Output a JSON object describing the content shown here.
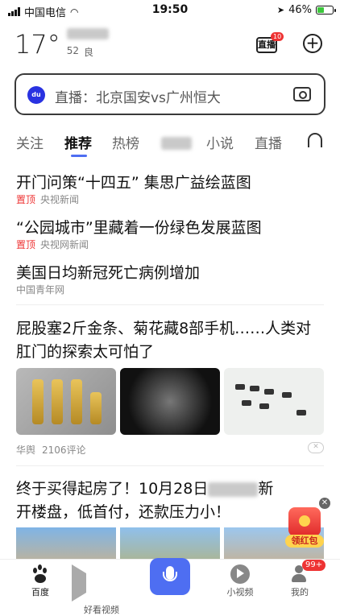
{
  "status_bar": {
    "carrier": "中国电信",
    "time": "19:50",
    "battery": "46%",
    "battery_level": 0.46
  },
  "weather": {
    "temperature": "17°",
    "aqi_value": "52",
    "aqi_label": "良"
  },
  "header": {
    "live_label": "直播",
    "live_badge": "10"
  },
  "search": {
    "text": "直播：北京国安vs广州恒大"
  },
  "tabs": [
    "关注",
    "推荐",
    "热榜",
    "小说",
    "直播"
  ],
  "top_news": [
    {
      "title": "开门问策“十四五” 集思广益绘蓝图",
      "pinned": "置顶",
      "source": "央视新闻"
    },
    {
      "title": "“公园城市”里藏着一份绿色发展蓝图",
      "pinned": "置顶",
      "source": "央视网新闻"
    },
    {
      "title": "美国日均新冠死亡病例增加",
      "pinned": "",
      "source": "中国青年网"
    }
  ],
  "article1": {
    "title": "屁股塞2斤金条、菊花藏8部手机……人类对肛门的探索太可怕了",
    "source": "华舆",
    "comments": "2106评论"
  },
  "article2": {
    "title_part1": "终于买得起房了！10月28日",
    "title_part2": "新开楼盘，低首付，还款压力小！"
  },
  "red_packet": {
    "label": "领红包"
  },
  "bottom_nav": [
    {
      "label": "百度"
    },
    {
      "label": "好看视频"
    },
    {
      "label": "小视频"
    },
    {
      "label": "我的"
    }
  ],
  "profile_badge": "99+",
  "colors": {
    "accent": "#4e6ef2",
    "pinned_red": "#e33333"
  }
}
